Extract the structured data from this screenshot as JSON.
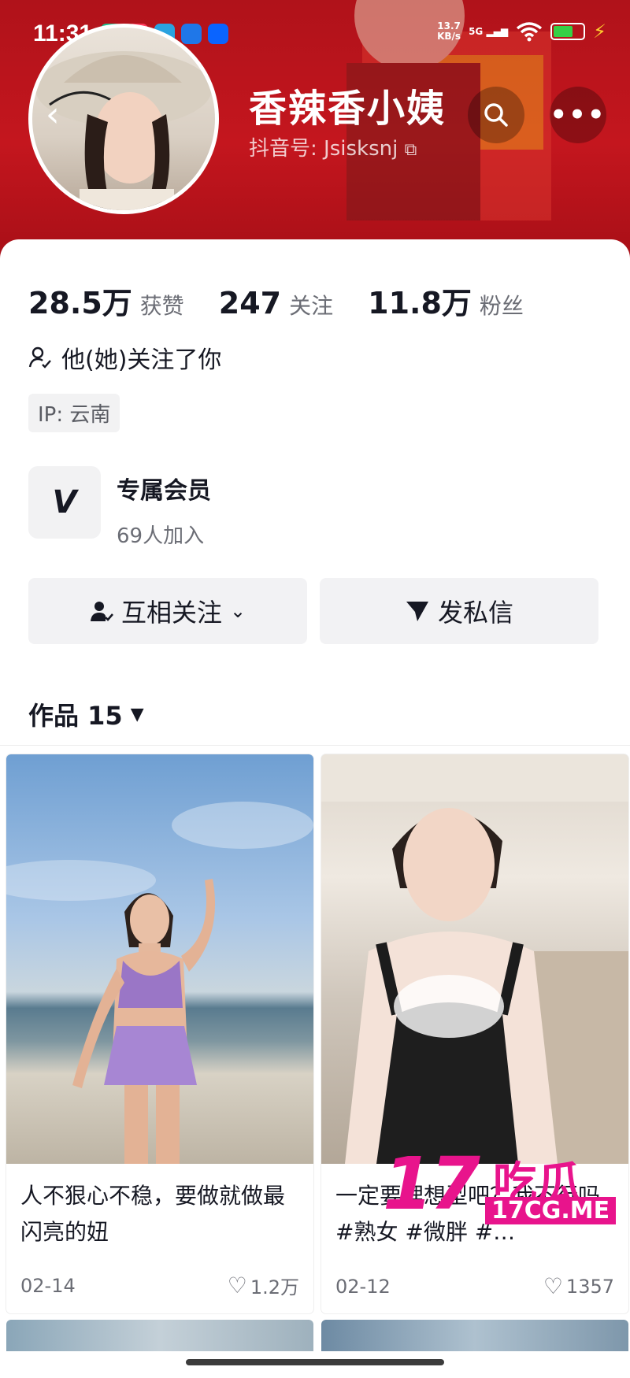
{
  "status_bar": {
    "time": "11:31",
    "net_speed": "13.7\nKB/s",
    "signal": "5G"
  },
  "profile": {
    "nickname": "香辣香小姨",
    "douyin_id": "抖音号: Jsisksnj",
    "stats": [
      {
        "value": "28.5万",
        "label": "获赞"
      },
      {
        "value": "247",
        "label": "关注"
      },
      {
        "value": "11.8万",
        "label": "粉丝"
      }
    ],
    "follows_you": "他(她)关注了你",
    "ip": "IP: 云南"
  },
  "member": {
    "title": "专属会员",
    "count": "69人加入"
  },
  "actions": {
    "follow_label": "互相关注",
    "message_label": "发私信"
  },
  "works_tab": {
    "label": "作品 15"
  },
  "posts": [
    {
      "caption": "人不狠心不稳，要做就做最闪亮的妞",
      "date": "02-14",
      "likes": "1.2万"
    },
    {
      "caption": "一定要理想型吧？我不行吗#熟女 #微胖 #…",
      "date": "02-12",
      "likes": "1357"
    }
  ],
  "watermark": {
    "number": "17",
    "chinese": "吃瓜",
    "domain": "17CG.ME"
  },
  "colors": {
    "header_red": "#c4161e",
    "watermark_pink": "#e8148c"
  }
}
